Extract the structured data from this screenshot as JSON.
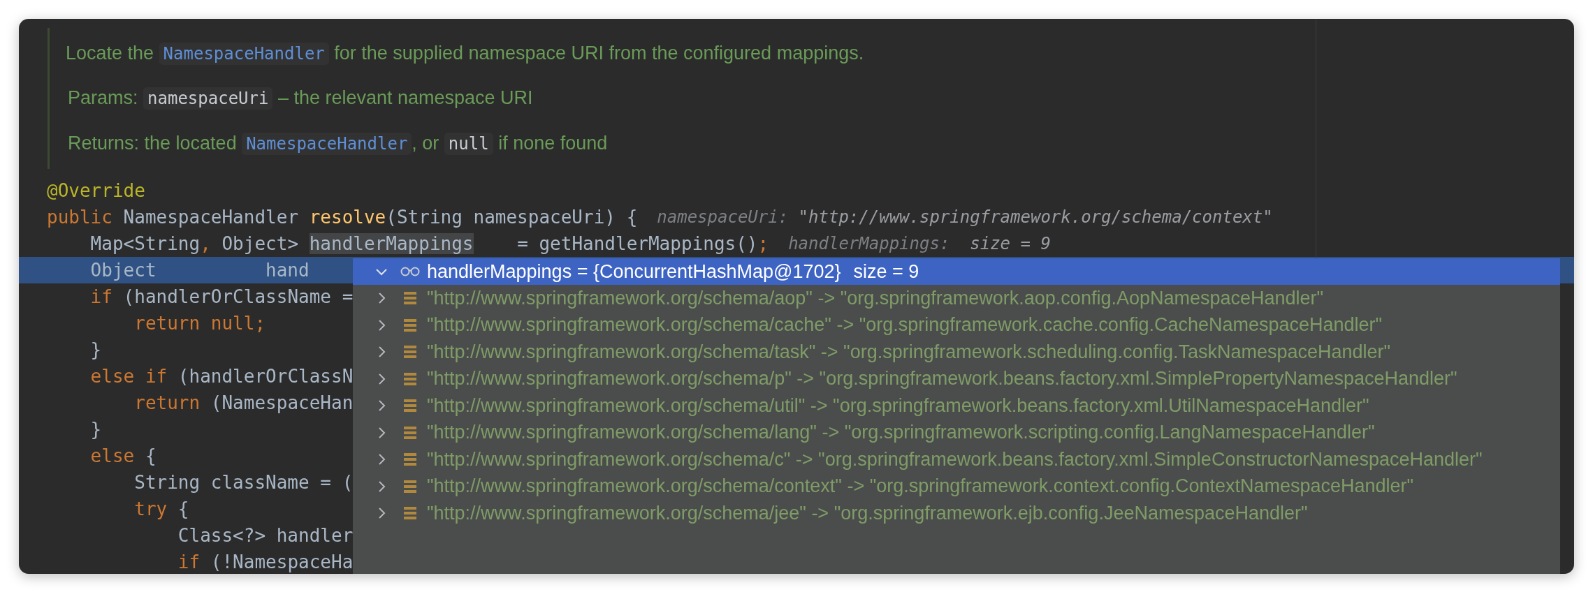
{
  "doc": {
    "lines": [
      {
        "segments": [
          {
            "text": "Locate the ",
            "kind": "text"
          },
          {
            "text": "NamespaceHandler",
            "kind": "link"
          },
          {
            "text": " for the supplied namespace URI from the configured mappings.",
            "kind": "text"
          }
        ]
      },
      {
        "segments": [
          {
            "text": "Params: ",
            "kind": "text"
          },
          {
            "text": "namespaceUri",
            "kind": "code"
          },
          {
            "text": " – the relevant namespace URI",
            "kind": "text"
          }
        ]
      },
      {
        "segments": [
          {
            "text": "Returns: the located ",
            "kind": "text"
          },
          {
            "text": "NamespaceHandler",
            "kind": "link"
          },
          {
            "text": ", or ",
            "kind": "text"
          },
          {
            "text": "null",
            "kind": "code"
          },
          {
            "text": " if none found",
            "kind": "text"
          }
        ]
      }
    ]
  },
  "lines": [
    {
      "selected": false,
      "tokens": [
        {
          "text": "@Override",
          "kind": "annotation"
        }
      ]
    },
    {
      "selected": false,
      "tokens": [
        {
          "text": "public ",
          "kind": "keyword"
        },
        {
          "text": "NamespaceHandler ",
          "kind": "plain"
        },
        {
          "text": "resolve",
          "kind": "method"
        },
        {
          "text": "(String namespaceUri) {",
          "kind": "plain"
        }
      ],
      "hint": {
        "label": "namespaceUri: ",
        "value": "\"http://www.springframework.org/schema/context\""
      }
    },
    {
      "selected": false,
      "tokens": [
        {
          "text": "    Map<String",
          "kind": "plain"
        },
        {
          "text": ", ",
          "kind": "keyword"
        },
        {
          "text": "Object> ",
          "kind": "plain"
        },
        {
          "text": "handlerMappings",
          "kind": "usage"
        },
        {
          "text": "    = getHandlerMappings()",
          "kind": "plain"
        },
        {
          "text": ";",
          "kind": "keyword"
        }
      ],
      "hint": {
        "label": "handlerMappings: ",
        "value": " size = 9"
      }
    },
    {
      "selected": true,
      "tokens": [
        {
          "text": "    Object          hand",
          "kind": "plain"
        }
      ]
    },
    {
      "selected": false,
      "tokens": [
        {
          "text": "    if ",
          "kind": "keyword"
        },
        {
          "text": "(handlerOrClassName =",
          "kind": "plain"
        }
      ]
    },
    {
      "selected": false,
      "tokens": [
        {
          "text": "        return null;",
          "kind": "keyword"
        }
      ]
    },
    {
      "selected": false,
      "tokens": [
        {
          "text": "    }",
          "kind": "plain"
        }
      ]
    },
    {
      "selected": false,
      "tokens": [
        {
          "text": "    else if ",
          "kind": "keyword"
        },
        {
          "text": "(handlerOrClassN",
          "kind": "plain"
        }
      ]
    },
    {
      "selected": false,
      "tokens": [
        {
          "text": "        return ",
          "kind": "keyword"
        },
        {
          "text": "(NamespaceHan",
          "kind": "plain"
        }
      ]
    },
    {
      "selected": false,
      "tokens": [
        {
          "text": "    }",
          "kind": "plain"
        }
      ]
    },
    {
      "selected": false,
      "tokens": [
        {
          "text": "    else ",
          "kind": "keyword"
        },
        {
          "text": "{",
          "kind": "plain"
        }
      ]
    },
    {
      "selected": false,
      "tokens": [
        {
          "text": "        String className = (",
          "kind": "plain"
        }
      ]
    },
    {
      "selected": false,
      "tokens": [
        {
          "text": "        try ",
          "kind": "keyword"
        },
        {
          "text": "{",
          "kind": "plain"
        }
      ]
    },
    {
      "selected": false,
      "tokens": [
        {
          "text": "            Class<?> handler",
          "kind": "plain"
        }
      ]
    },
    {
      "selected": false,
      "tokens": [
        {
          "text": "            if ",
          "kind": "keyword"
        },
        {
          "text": "(!NamespaceHa",
          "kind": "plain"
        }
      ]
    }
  ],
  "popup": {
    "header": {
      "expanded": true,
      "name": "handlerMappings = {ConcurrentHashMap@1702}",
      "size": "size = 9"
    },
    "rows": [
      {
        "expanded": false,
        "text": "\"http://www.springframework.org/schema/aop\" -> \"org.springframework.aop.config.AopNamespaceHandler\""
      },
      {
        "expanded": false,
        "text": "\"http://www.springframework.org/schema/cache\" -> \"org.springframework.cache.config.CacheNamespaceHandler\""
      },
      {
        "expanded": false,
        "text": "\"http://www.springframework.org/schema/task\" -> \"org.springframework.scheduling.config.TaskNamespaceHandler\""
      },
      {
        "expanded": false,
        "text": "\"http://www.springframework.org/schema/p\" -> \"org.springframework.beans.factory.xml.SimplePropertyNamespaceHandler\""
      },
      {
        "expanded": false,
        "text": "\"http://www.springframework.org/schema/util\" -> \"org.springframework.beans.factory.xml.UtilNamespaceHandler\""
      },
      {
        "expanded": false,
        "text": "\"http://www.springframework.org/schema/lang\" -> \"org.springframework.scripting.config.LangNamespaceHandler\""
      },
      {
        "expanded": false,
        "text": "\"http://www.springframework.org/schema/c\" -> \"org.springframework.beans.factory.xml.SimpleConstructorNamespaceHandler\""
      },
      {
        "expanded": false,
        "text": "\"http://www.springframework.org/schema/context\" -> \"org.springframework.context.config.ContextNamespaceHandler\""
      },
      {
        "expanded": false,
        "text": "\"http://www.springframework.org/schema/jee\" -> \"org.springframework.ejb.config.JeeNamespaceHandler\""
      }
    ]
  }
}
